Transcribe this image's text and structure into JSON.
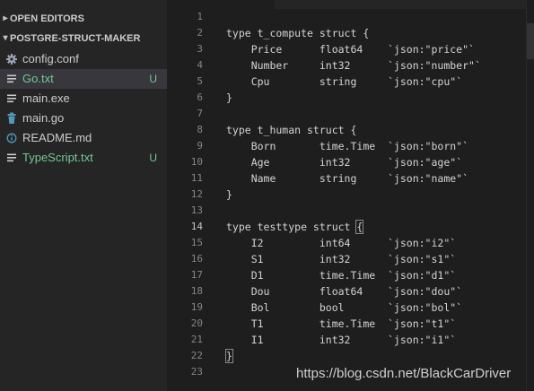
{
  "explorer": {
    "sections": [
      {
        "label": "OPEN EDITORS",
        "expanded": false
      },
      {
        "label": "POSTGRE-STRUCT-MAKER",
        "expanded": true
      }
    ],
    "files": [
      {
        "name": "config.conf",
        "icon": "gear-icon",
        "badge": "",
        "modified": false,
        "selected": false
      },
      {
        "name": "Go.txt",
        "icon": "lines-icon",
        "badge": "U",
        "modified": true,
        "selected": true
      },
      {
        "name": "main.exe",
        "icon": "lines-icon",
        "badge": "",
        "modified": false,
        "selected": false
      },
      {
        "name": "main.go",
        "icon": "trash-icon",
        "badge": "",
        "modified": false,
        "selected": false
      },
      {
        "name": "README.md",
        "icon": "info-icon",
        "badge": "",
        "modified": false,
        "selected": false
      },
      {
        "name": "TypeScript.txt",
        "icon": "lines-icon",
        "badge": "U",
        "modified": true,
        "selected": false
      }
    ]
  },
  "editor": {
    "current_line": 14,
    "lines": [
      "",
      "type t_compute struct {",
      "    Price      float64    `json:\"price\"`",
      "    Number     int32      `json:\"number\"`",
      "    Cpu        string     `json:\"cpu\"`",
      "}",
      "",
      "type t_human struct {",
      "    Born       time.Time  `json:\"born\"`",
      "    Age        int32      `json:\"age\"`",
      "    Name       string     `json:\"name\"`",
      "}",
      "",
      "type testtype struct {",
      "    I2         int64      `json:\"i2\"`",
      "    S1         int32      `json:\"s1\"`",
      "    D1         time.Time  `json:\"d1\"`",
      "    Dou        float64    `json:\"dou\"`",
      "    Bol        bool       `json:\"bol\"`",
      "    T1         time.Time  `json:\"t1\"`",
      "    I1         int32      `json:\"i1\"`",
      "}",
      ""
    ]
  },
  "watermark": "https://blog.csdn.net/BlackCarDriver",
  "colors": {
    "untracked": "#73c991",
    "background": "#1e1e1e",
    "sidebar": "#252526"
  }
}
